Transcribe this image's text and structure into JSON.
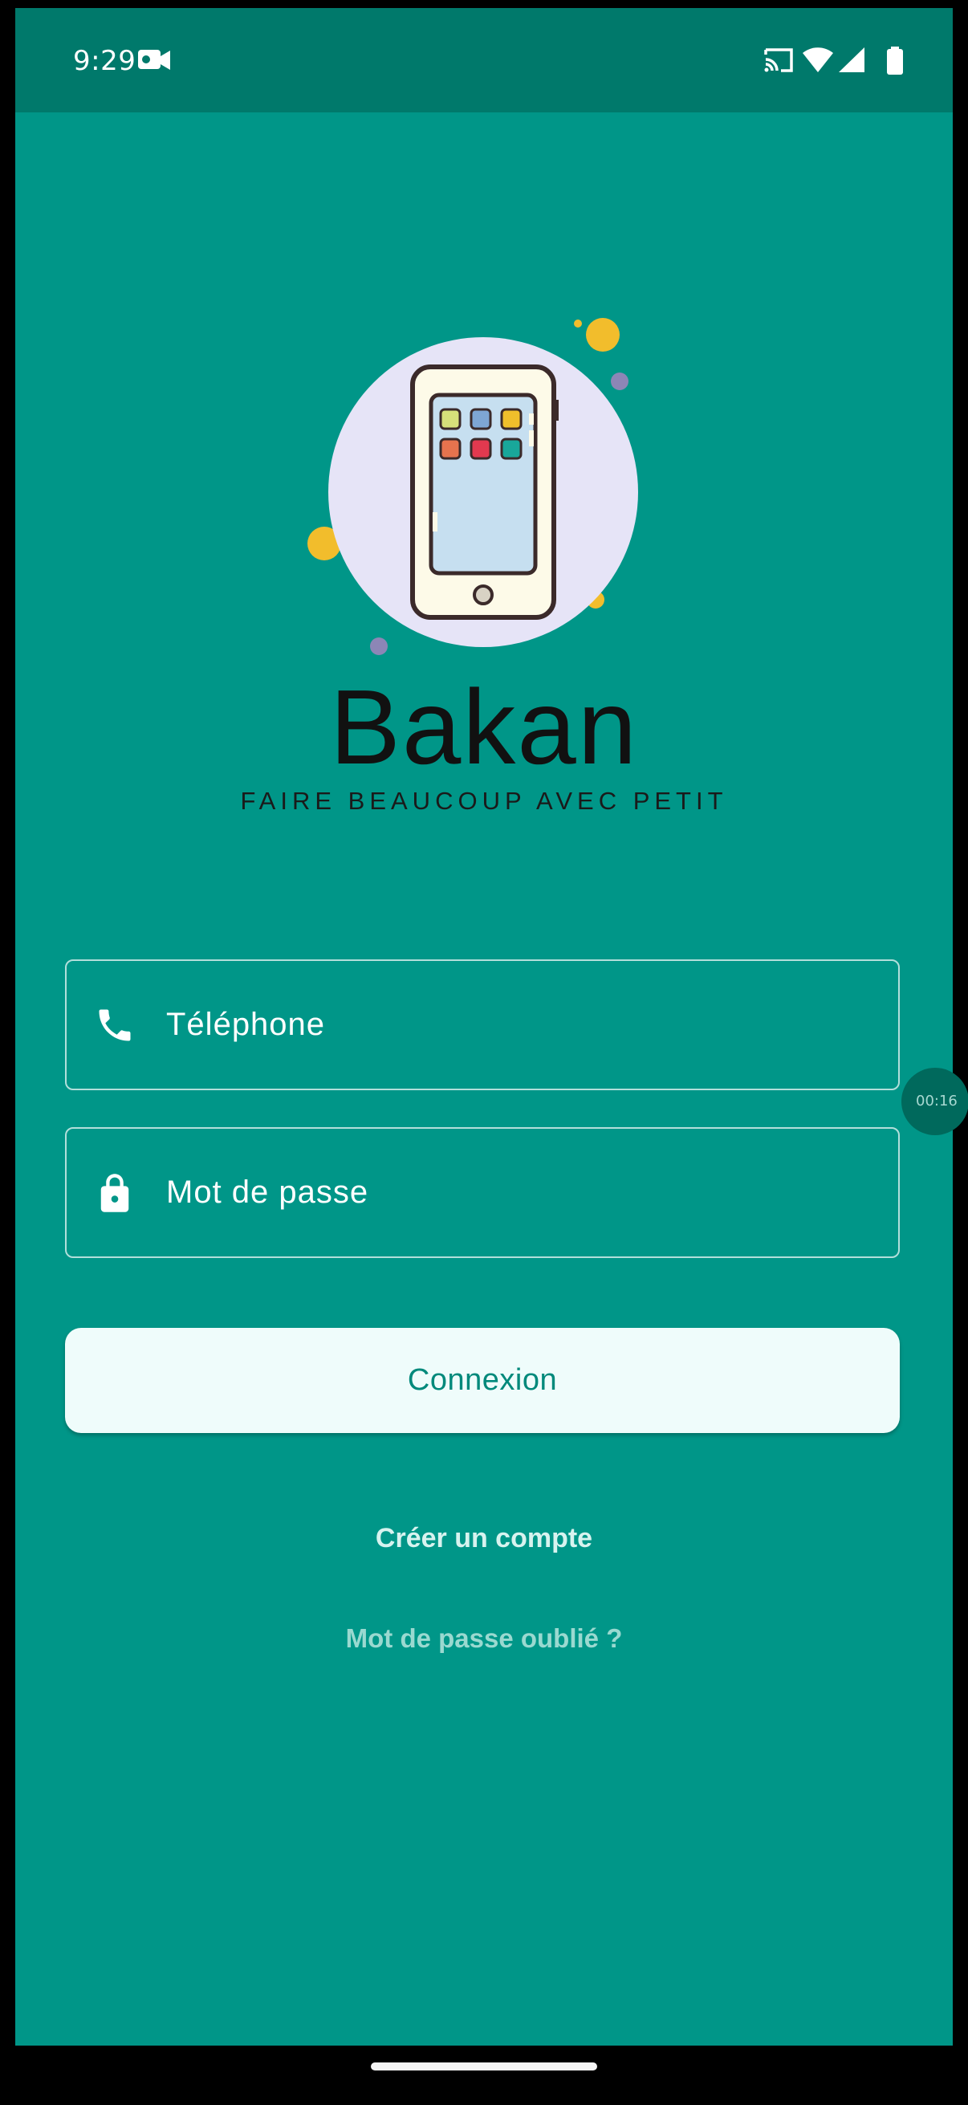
{
  "status_bar": {
    "time": "9:29",
    "icons": [
      "video-recording-icon",
      "cast-icon",
      "wifi-icon",
      "signal-icon",
      "battery-icon"
    ]
  },
  "app": {
    "brand": "Bakan",
    "tagline": "FAIRE BEAUCOUP AVEC PETIT",
    "logo": "smartphone-illustration"
  },
  "form": {
    "phone_placeholder": "Téléphone",
    "password_placeholder": "Mot de passe",
    "login_label": "Connexion",
    "create_account_label": "Créer un compte",
    "forgot_password_label": "Mot de passe oublié ?"
  },
  "overlay": {
    "timer": "00:16"
  },
  "colors": {
    "background": "#009688",
    "status_bar": "#00796b",
    "button_bg": "#effcfb",
    "button_text": "#00897b"
  }
}
